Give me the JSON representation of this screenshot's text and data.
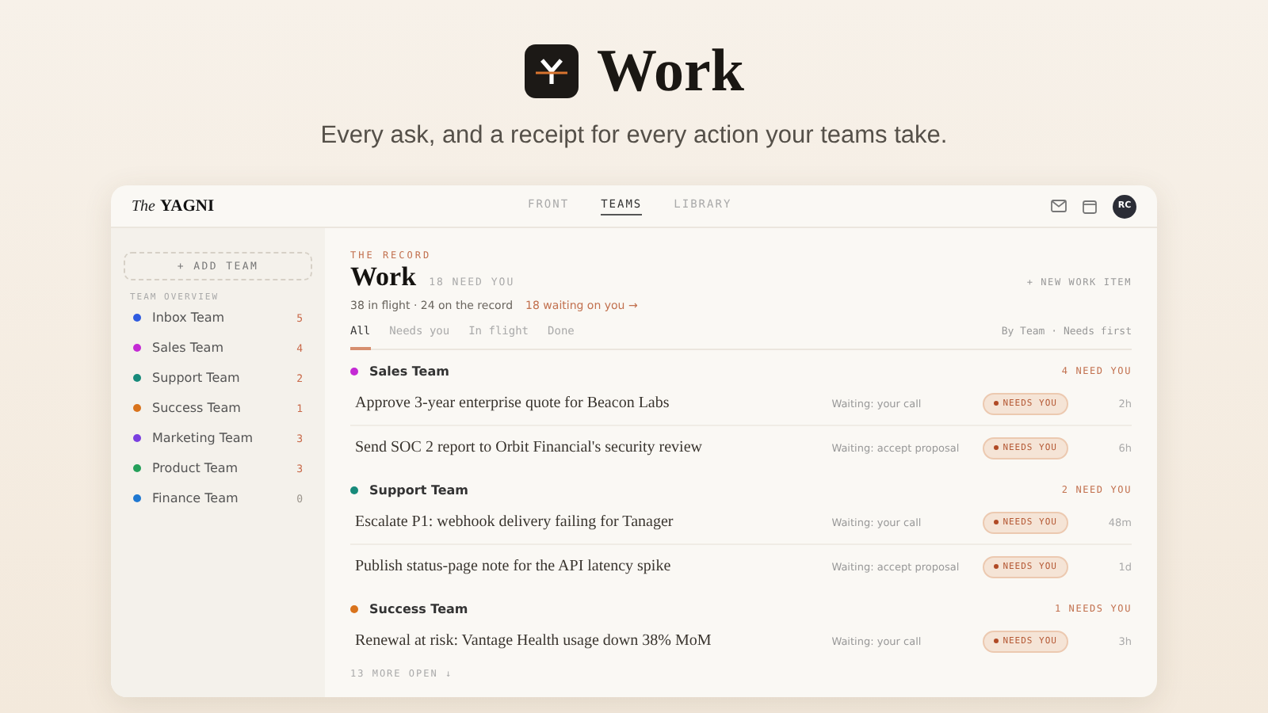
{
  "hero": {
    "title": "Work",
    "tagline": "Every ask, and a receipt for every action your teams take."
  },
  "app": {
    "brand_prefix": "The",
    "brand": "YAGNI",
    "nav": [
      {
        "label": "FRONT",
        "selected": false
      },
      {
        "label": "TEAMS",
        "selected": true
      },
      {
        "label": "LIBRARY",
        "selected": false
      }
    ],
    "avatar": "RC"
  },
  "sidebar": {
    "add_button": "+ ADD TEAM",
    "heading": "TEAM OVERVIEW",
    "items": [
      {
        "name": "Inbox Team",
        "count": "5",
        "color": "#2f5be0",
        "dim": false
      },
      {
        "name": "Sales Team",
        "count": "4",
        "color": "#c42ad4",
        "dim": false
      },
      {
        "name": "Support Team",
        "count": "2",
        "color": "#178a7a",
        "dim": false
      },
      {
        "name": "Success Team",
        "count": "1",
        "color": "#d9731c",
        "dim": false
      },
      {
        "name": "Marketing Team",
        "count": "3",
        "color": "#7a3fe0",
        "dim": false
      },
      {
        "name": "Product Team",
        "count": "3",
        "color": "#25a05a",
        "dim": false
      },
      {
        "name": "Finance Team",
        "count": "0",
        "color": "#1f78d1",
        "dim": true
      }
    ]
  },
  "main": {
    "eyebrow": "THE RECORD",
    "title": "Work",
    "title_badge": "18 NEED YOU",
    "new_button": "+ NEW WORK ITEM",
    "summary": "38 in flight · 24 on the record",
    "waiting_link": "18 waiting on you →",
    "filters": [
      {
        "label": "All",
        "selected": true
      },
      {
        "label": "Needs you",
        "selected": false
      },
      {
        "label": "In flight",
        "selected": false
      },
      {
        "label": "Done",
        "selected": false
      }
    ],
    "sort": "By Team · Needs first",
    "groups": [
      {
        "name": "Sales Team",
        "color": "#c42ad4",
        "need": "4 NEED YOU",
        "items": [
          {
            "title": "Approve 3-year enterprise quote for Beacon Labs",
            "status": "Waiting: your call",
            "badge": "NEEDS YOU",
            "age": "2h"
          },
          {
            "title": "Send SOC 2 report to Orbit Financial's security review",
            "status": "Waiting: accept proposal",
            "badge": "NEEDS YOU",
            "age": "6h"
          }
        ]
      },
      {
        "name": "Support Team",
        "color": "#178a7a",
        "need": "2 NEED YOU",
        "items": [
          {
            "title": "Escalate P1: webhook delivery failing for Tanager",
            "status": "Waiting: your call",
            "badge": "NEEDS YOU",
            "age": "48m"
          },
          {
            "title": "Publish status-page note for the API latency spike",
            "status": "Waiting: accept proposal",
            "badge": "NEEDS YOU",
            "age": "1d"
          }
        ]
      },
      {
        "name": "Success Team",
        "color": "#d9731c",
        "need": "1 NEEDS YOU",
        "items": [
          {
            "title": "Renewal at risk: Vantage Health usage down 38% MoM",
            "status": "Waiting: your call",
            "badge": "NEEDS YOU",
            "age": "3h"
          }
        ]
      }
    ],
    "more": "13 MORE OPEN ↓"
  }
}
